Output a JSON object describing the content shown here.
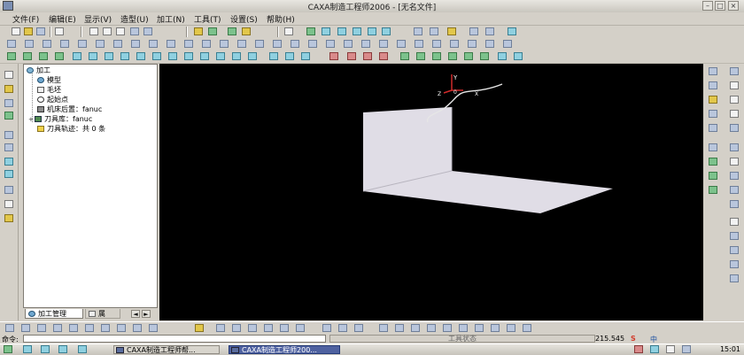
{
  "window": {
    "title": "CAXA制造工程师2006 - [无名文件]",
    "minimize_glyph": "–",
    "restore_glyph": "□",
    "close_glyph": "×"
  },
  "menu": [
    {
      "label": "文件(F)"
    },
    {
      "label": "编辑(E)"
    },
    {
      "label": "显示(V)"
    },
    {
      "label": "造型(U)"
    },
    {
      "label": "加工(N)"
    },
    {
      "label": "工具(T)"
    },
    {
      "label": "设置(S)"
    },
    {
      "label": "帮助(H)"
    }
  ],
  "tree": {
    "root": "加工",
    "items": [
      {
        "label": "模型",
        "icon": "model-icon"
      },
      {
        "label": "毛坯",
        "icon": "blank-icon"
      },
      {
        "label": "起始点",
        "icon": "start-point-icon"
      },
      {
        "label": "机床后置：fanuc",
        "icon": "machine-post-icon"
      },
      {
        "label": "刀具库：fanuc",
        "icon": "tool-library-icon"
      },
      {
        "label": "刀具轨迹：共 0 条",
        "icon": "toolpath-folder-icon"
      }
    ],
    "expand_glyph": "+",
    "tabs": [
      {
        "label": "加工管理",
        "active": true
      },
      {
        "label": "属",
        "active": false
      }
    ],
    "nav_prev": "◄",
    "nav_next": "►"
  },
  "viewport": {
    "background": "#000000",
    "axis_labels": {
      "y": "Y",
      "z": "Z",
      "x": "X",
      "origin": "0"
    },
    "surface_color": "#e0dde6"
  },
  "status": {
    "command_label": "命令:",
    "status_text": "工具状态",
    "coordinate": "215.545"
  },
  "taskbar": {
    "tasks": [
      {
        "label": "CAXA制造工程师帮...",
        "active": false
      },
      {
        "label": "CAXA制造工程师200...",
        "active": true
      }
    ],
    "clock": "15:01",
    "ime_text": "中"
  }
}
